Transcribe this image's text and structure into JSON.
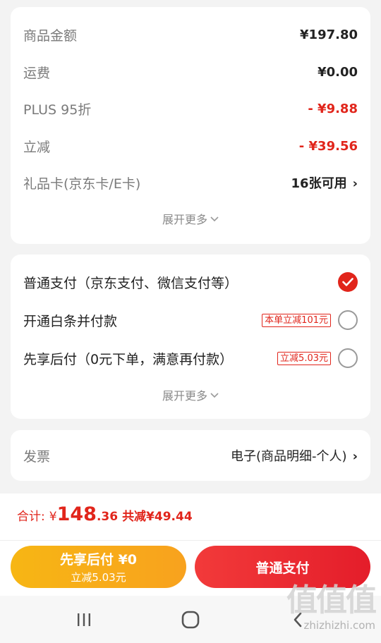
{
  "summary": {
    "goods_amount": {
      "label": "商品金额",
      "value": "¥197.80"
    },
    "shipping": {
      "label": "运费",
      "value": "¥0.00"
    },
    "plus": {
      "label": "PLUS 95折",
      "value": "- ¥9.88"
    },
    "instant_discount": {
      "label": "立减",
      "value": "- ¥39.56"
    },
    "gift_card": {
      "label": "礼品卡(京东卡/E卡)",
      "value": "16张可用"
    },
    "expand_label": "展开更多"
  },
  "payment": {
    "options": [
      {
        "label": "普通支付（京东支付、微信支付等）",
        "tag": "",
        "checked": true
      },
      {
        "label": "开通白条并付款",
        "tag": "本单立减101元",
        "checked": false
      },
      {
        "label": "先享后付（0元下单，满意再付款）",
        "tag": "立减5.03元",
        "checked": false
      }
    ],
    "expand_label": "展开更多"
  },
  "invoice": {
    "label": "发票",
    "value": "电子(商品明细-个人)"
  },
  "footer": {
    "total_label": "合计:",
    "currency": "¥",
    "total_int": "148",
    "total_dec": ".36",
    "discount_text": "共减¥49.44",
    "bnpl_button": {
      "title": "先享后付 ¥0",
      "subtitle": "立减5.03元"
    },
    "normal_button": {
      "title": "普通支付"
    }
  },
  "watermark": {
    "logo": "值值值",
    "url": "zhizhizhi.com"
  },
  "colors": {
    "accent": "#e1251b",
    "bnpl": "#f7b614"
  }
}
